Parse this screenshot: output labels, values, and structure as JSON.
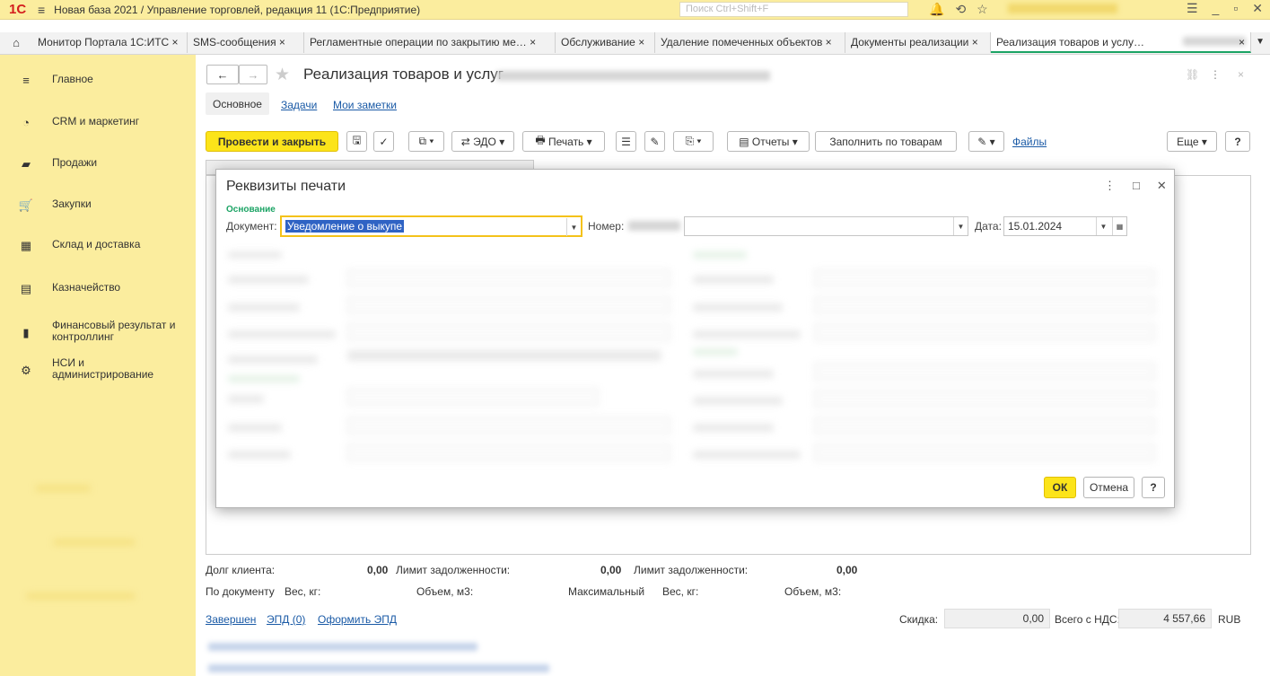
{
  "app": {
    "window_title": "Новая база 2021 / Управление торговлей, редакция 11  (1С:Предприятие)",
    "search_placeholder": "Поиск Ctrl+Shift+F"
  },
  "tabs": [
    {
      "label": "Монитор Портала 1С:ИТС ×"
    },
    {
      "label": "SMS-сообщения ×"
    },
    {
      "label": "Регламентные операции по закрытию ме… ×"
    },
    {
      "label": "Обслуживание ×"
    },
    {
      "label": "Удаление помеченных объектов ×"
    },
    {
      "label": "Документы реализации ×"
    },
    {
      "label": "Реализация товаров и услу…"
    }
  ],
  "sidebar": {
    "items": [
      {
        "label": "Главное",
        "icon": "menu-icon",
        "glyph": "≡"
      },
      {
        "label": "CRM и маркетинг",
        "icon": "pie-chart-icon",
        "glyph": "◔"
      },
      {
        "label": "Продажи",
        "icon": "shopping-bag-icon",
        "glyph": "▰"
      },
      {
        "label": "Закупки",
        "icon": "cart-icon",
        "glyph": "🛒"
      },
      {
        "label": "Склад и доставка",
        "icon": "warehouse-icon",
        "glyph": "▦"
      },
      {
        "label": "Казначейство",
        "icon": "money-icon",
        "glyph": "▤"
      },
      {
        "label": "Финансовый результат и\nконтроллинг",
        "icon": "bar-chart-icon",
        "glyph": "▮"
      },
      {
        "label": "НСИ и\nадминистрирование",
        "icon": "gear-icon",
        "glyph": "⚙"
      }
    ]
  },
  "document": {
    "title": "Реализация товаров и услуг",
    "subtabs": [
      "Основное",
      "Задачи",
      "Мои заметки"
    ],
    "toolbar": {
      "post_close": "Провести и закрыть",
      "edo": "ЭДО",
      "print": "Печать",
      "reports": "Отчеты",
      "fill_by_goods": "Заполнить по товарам",
      "files": "Файлы",
      "more": "Еще",
      "help": "?"
    }
  },
  "dialog": {
    "title": "Реквизиты печати",
    "group": "Основание",
    "document_label": "Документ:",
    "document_value": "Уведомление о выкупе",
    "number_label": "Номер:",
    "date_label": "Дата:",
    "date_value": "15.01.2024",
    "ok": "ОК",
    "cancel": "Отмена",
    "help": "?"
  },
  "footer": {
    "debt_label": "Долг клиента:",
    "debt_value": "0,00",
    "limit_label_1": "Лимит задолженности:",
    "limit_value_1": "0,00",
    "limit_label_2": "Лимит задолженности:",
    "limit_value_2": "0,00",
    "by_doc": "По документу",
    "weight_1": "Вес, кг:",
    "volume_1": "Объем, м3:",
    "max": "Максимальный",
    "weight_2": "Вес, кг:",
    "volume_2": "Объем, м3:",
    "status_link": "Завершен",
    "epd_link": "ЭПД (0)",
    "make_epd_link": "Оформить ЭПД",
    "discount_label": "Скидка:",
    "discount_value": "0,00",
    "total_label": "Всего с НДС:",
    "total_value": "4 557,66",
    "currency": "RUB"
  }
}
